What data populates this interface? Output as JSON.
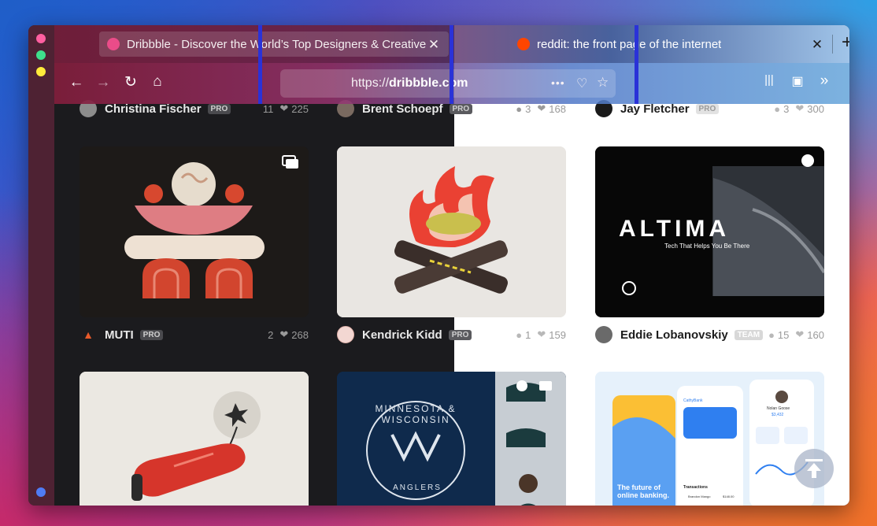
{
  "browser": {
    "tabs": [
      {
        "title": "Dribbble - Discover the World’s Top Designers & Creative",
        "close": "✕"
      },
      {
        "title": "reddit: the front page of the internet",
        "close": "✕"
      }
    ],
    "new_tab": "+",
    "url_prefix": "https://",
    "url_domain": "dribbble.com",
    "url_more": "•••"
  },
  "feed": {
    "top_row": [
      {
        "author": "Christina Fischer",
        "badge": "PRO",
        "comments": "11",
        "likes": "225"
      },
      {
        "author": "Brent Schoepf",
        "badge": "PRO",
        "comments": "3",
        "likes": "168"
      },
      {
        "author": "Jay Fletcher",
        "badge": "PRO",
        "comments": "3",
        "likes": "300"
      }
    ],
    "shots": [
      {
        "author": "MUTI",
        "badge": "PRO",
        "comments": "2",
        "likes": "268"
      },
      {
        "author": "Kendrick Kidd",
        "badge": "PRO",
        "comments": "1",
        "likes": "159"
      },
      {
        "author": "Eddie Lobanovskiy",
        "badge": "TEAM",
        "comments": "15",
        "likes": "160"
      }
    ],
    "altima": {
      "title": "ALTIMA",
      "tagline": "Tech That Helps You Be There"
    },
    "banking": {
      "headline1": "The future of",
      "headline2": "online banking.",
      "brand": "CathyBank",
      "user": "Nolan Goose",
      "amount": "$3,432",
      "transactions": "Transactions",
      "payee": "Brandon Mango",
      "tx_amount": "$148.00"
    },
    "badge_text": {
      "top": "MINNESOTA & WISCONSIN",
      "bottom": "ANGLERS"
    }
  }
}
